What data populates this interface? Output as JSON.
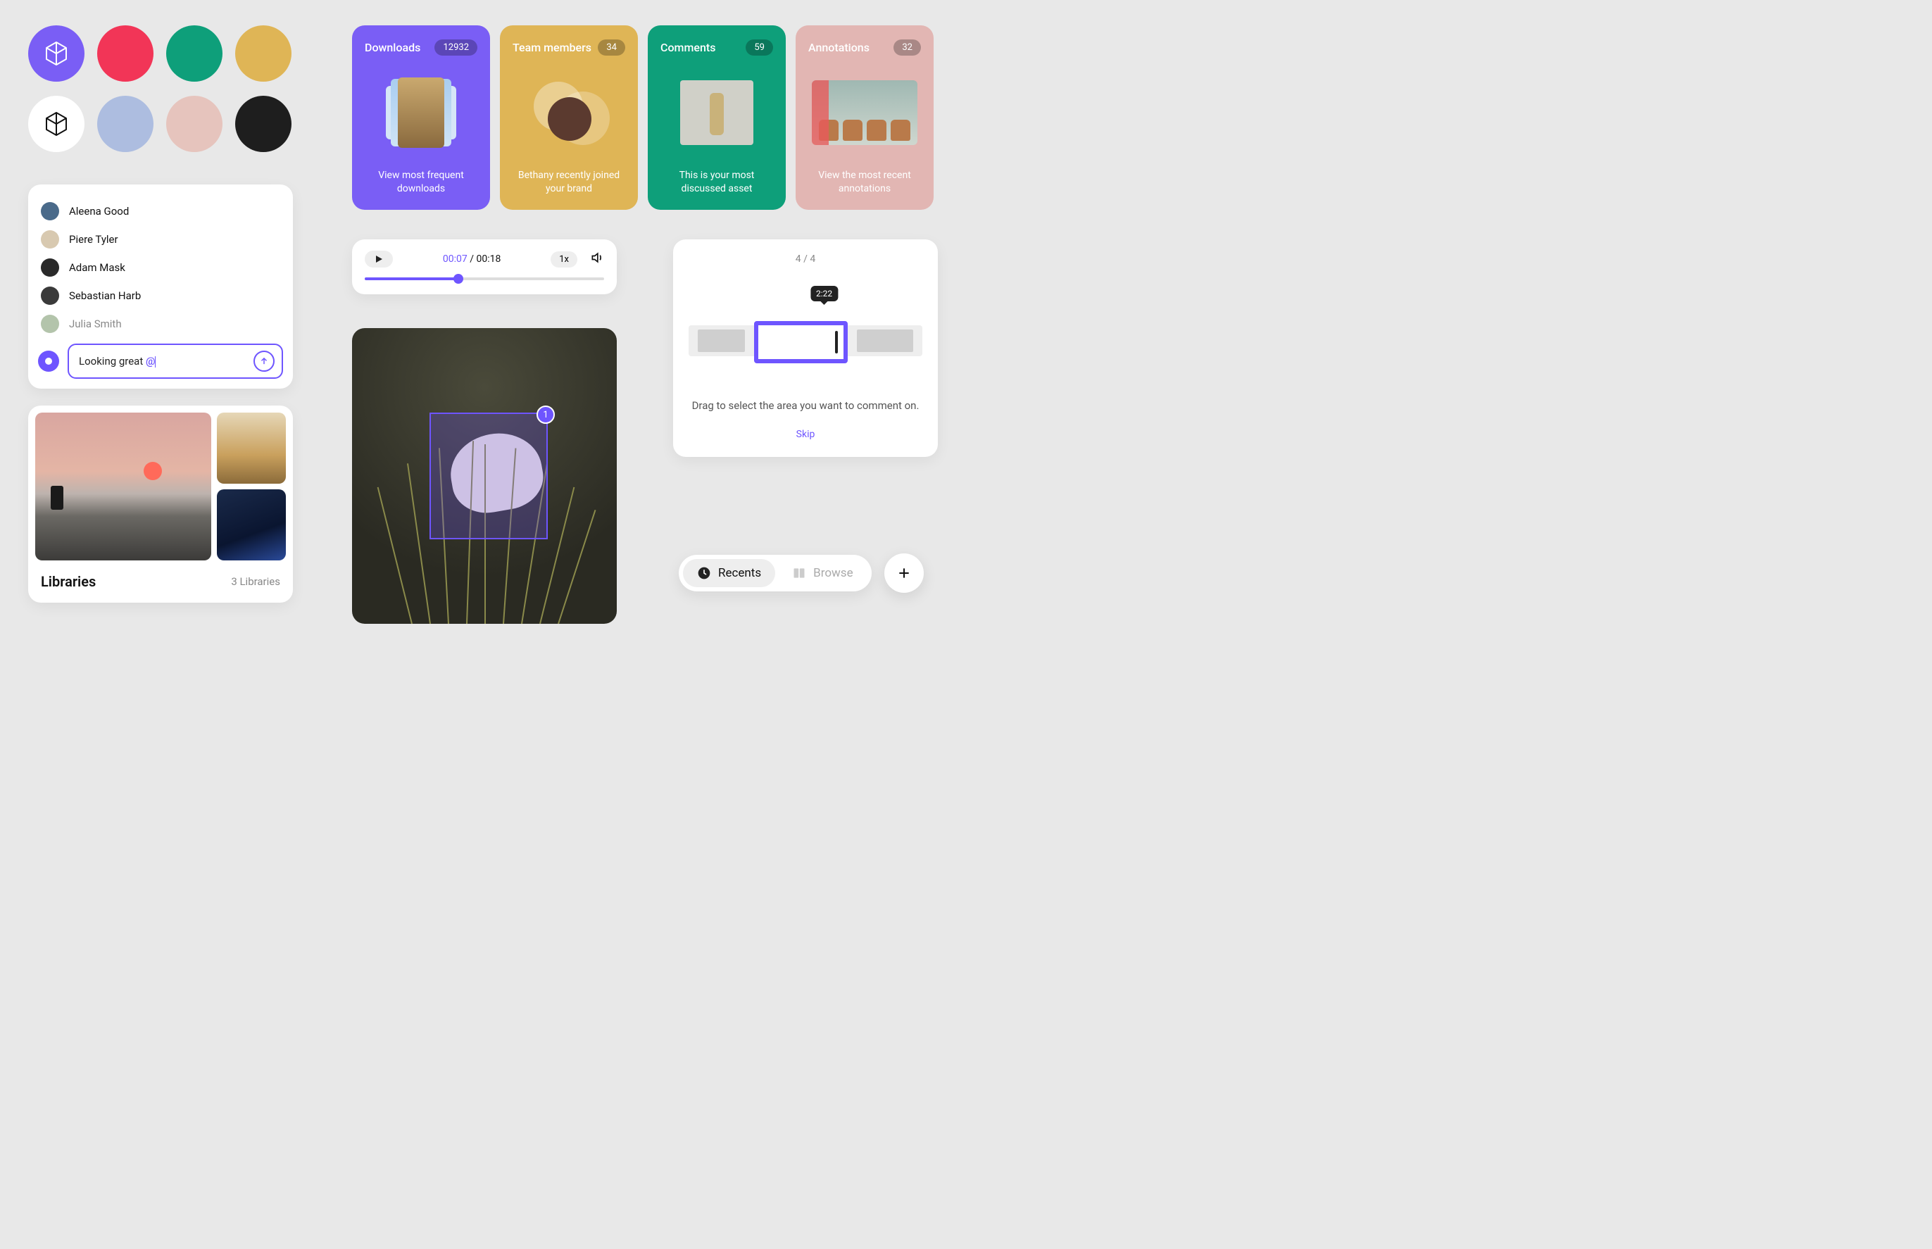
{
  "palette": {
    "row1": [
      "#7a5ef5",
      "#f23557",
      "#0e9f7a",
      "#dfb556"
    ],
    "row2": [
      "#ffffff",
      "#adbde0",
      "#e6c4bd",
      "#1e1e1e"
    ]
  },
  "people": {
    "items": [
      {
        "name": "Aleena Good"
      },
      {
        "name": "Piere Tyler"
      },
      {
        "name": "Adam Mask"
      },
      {
        "name": "Sebastian Harb"
      },
      {
        "name": "Julia Smith"
      }
    ],
    "composer_text": "Looking great ",
    "composer_mention": "@"
  },
  "libraries": {
    "title": "Libraries",
    "count_label": "3 Libraries"
  },
  "stats": [
    {
      "title": "Downloads",
      "count": "12932",
      "caption": "View most frequent downloads"
    },
    {
      "title": "Team members",
      "count": "34",
      "caption": "Bethany recently joined your brand"
    },
    {
      "title": "Comments",
      "count": "59",
      "caption": "This is your most discussed asset"
    },
    {
      "title": "Annotations",
      "count": "32",
      "caption": "View the most recent annotations"
    }
  ],
  "audio": {
    "current": "00:07",
    "total": "00:18",
    "speed": "1x"
  },
  "asset": {
    "region_badge": "1"
  },
  "onboarding": {
    "step": "4 / 4",
    "timestamp": "2:22",
    "text": "Drag to select the area you want to comment on.",
    "skip": "Skip"
  },
  "nav": {
    "recents": "Recents",
    "browse": "Browse"
  }
}
